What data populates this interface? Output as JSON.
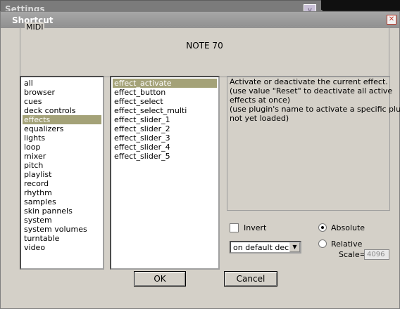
{
  "background_window": {
    "title": "Settings"
  },
  "dialog": {
    "title": "Shortcut"
  },
  "midi": {
    "legend": "MIDI",
    "value": "NOTE 70"
  },
  "categories": [
    {
      "label": "all"
    },
    {
      "label": "browser"
    },
    {
      "label": "cues"
    },
    {
      "label": "deck controls"
    },
    {
      "label": "effects",
      "selected": true
    },
    {
      "label": "equalizers"
    },
    {
      "label": "lights"
    },
    {
      "label": "loop"
    },
    {
      "label": "mixer"
    },
    {
      "label": "pitch"
    },
    {
      "label": "playlist"
    },
    {
      "label": "record"
    },
    {
      "label": "rhythm"
    },
    {
      "label": "samples"
    },
    {
      "label": "skin pannels"
    },
    {
      "label": "system"
    },
    {
      "label": "system volumes"
    },
    {
      "label": "turntable"
    },
    {
      "label": "video"
    }
  ],
  "commands": [
    {
      "label": "effect_activate",
      "selected": true
    },
    {
      "label": "effect_button"
    },
    {
      "label": "effect_select"
    },
    {
      "label": "effect_select_multi"
    },
    {
      "label": "effect_slider_1"
    },
    {
      "label": "effect_slider_2"
    },
    {
      "label": "effect_slider_3"
    },
    {
      "label": "effect_slider_4"
    },
    {
      "label": "effect_slider_5"
    }
  ],
  "description": [
    "Activate or deactivate the current effect.",
    "(use value \"Reset\" to deactivate all active",
    "effects at once)",
    "(use plugin's name to activate a specific plugin",
    "not yet loaded)"
  ],
  "options": {
    "invert_label": "Invert",
    "invert_checked": false,
    "absolute_label": "Absolute",
    "relative_label": "Relative",
    "mode": "absolute",
    "scale_label": "Scale=",
    "scale_value": "4096",
    "deck_value": "on default deck"
  },
  "buttons": {
    "ok": "OK",
    "cancel": "Cancel"
  },
  "colors": {
    "selection": "#a4a278",
    "dialog_bg": "#d4d0c8",
    "titlebar": "#999999"
  }
}
